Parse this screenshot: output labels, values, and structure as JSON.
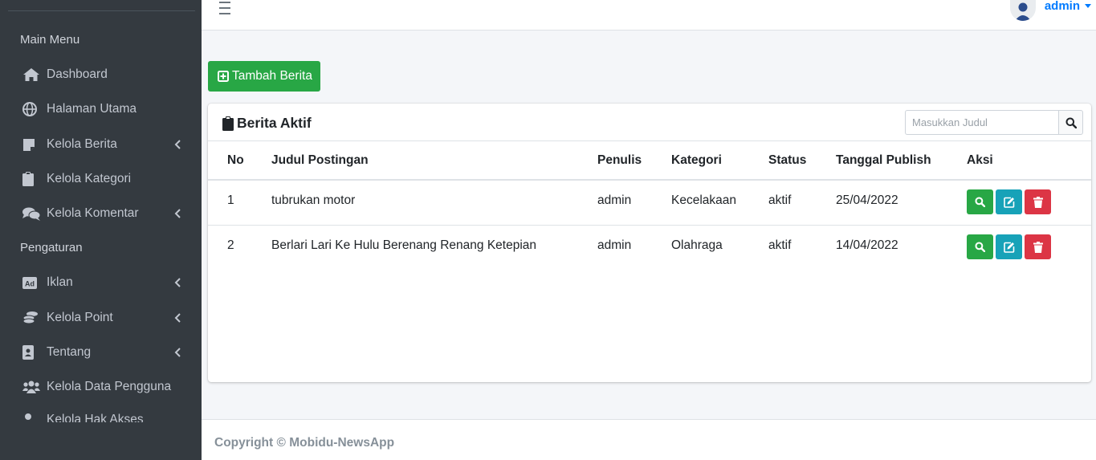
{
  "sidebar": {
    "header_main": "Main Menu",
    "header_settings": "Pengaturan",
    "items": [
      {
        "label": "Dashboard",
        "icon": "home-icon"
      },
      {
        "label": "Halaman Utama",
        "icon": "globe-icon"
      },
      {
        "label": "Kelola Berita",
        "icon": "newspaper-icon"
      },
      {
        "label": "Kelola Kategori",
        "icon": "clipboard-icon"
      },
      {
        "label": "Kelola Komentar",
        "icon": "comments-icon"
      },
      {
        "label": "Iklan",
        "icon": "ad-icon"
      },
      {
        "label": "Kelola Point",
        "icon": "coins-icon"
      },
      {
        "label": "Tentang",
        "icon": "id-badge-icon"
      },
      {
        "label": "Kelola Data Pengguna",
        "icon": "users-icon"
      },
      {
        "label": "Kelola Hak Akses",
        "icon": "user-icon"
      }
    ]
  },
  "topbar": {
    "user_name": "admin"
  },
  "actions": {
    "add_label": "Tambah Berita"
  },
  "card": {
    "title": "Berita Aktif",
    "search_placeholder": "Masukkan Judul"
  },
  "table": {
    "headers": [
      "No",
      "Judul Postingan",
      "Penulis",
      "Kategori",
      "Status",
      "Tanggal Publish",
      "Aksi"
    ],
    "rows": [
      {
        "no": "1",
        "judul": "tubrukan motor",
        "penulis": "admin",
        "kategori": "Kecelakaan",
        "status": "aktif",
        "tanggal": "25/04/2022"
      },
      {
        "no": "2",
        "judul": "Berlari Lari Ke Hulu Berenang Renang Ketepian",
        "penulis": "admin",
        "kategori": "Olahraga",
        "status": "aktif",
        "tanggal": "14/04/2022"
      }
    ]
  },
  "footer": {
    "copyright": "Copyright © Mobidu-NewsApp"
  },
  "colors": {
    "sidebar_bg": "#343a40",
    "primary": "#007bff",
    "success": "#28a745",
    "info": "#17a2b8",
    "danger": "#dc3545"
  }
}
